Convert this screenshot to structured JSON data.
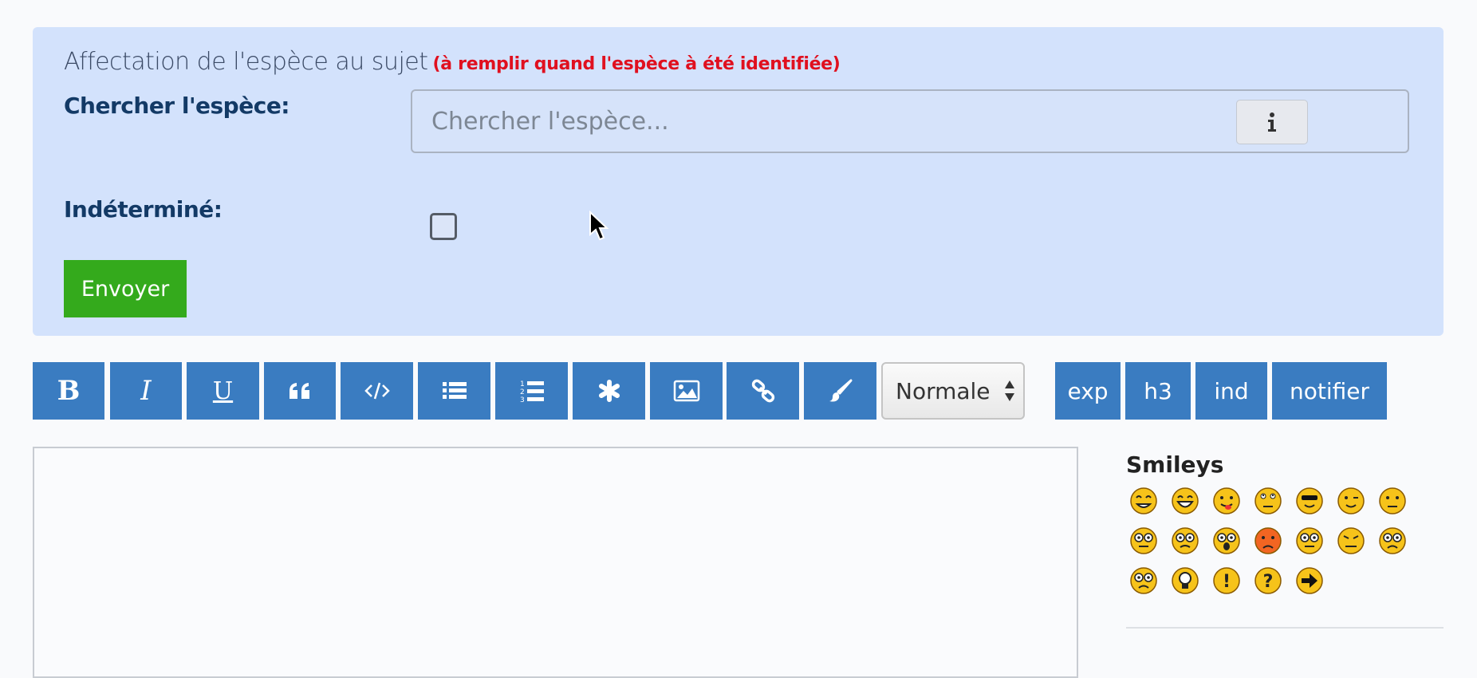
{
  "form": {
    "title": "Affectation de l'espèce au sujet",
    "hint": "(à remplir quand l'espèce à été identifiée)",
    "search_label": "Chercher l'espèce:",
    "search_placeholder": "Chercher l'espèce...",
    "search_value": "",
    "info_icon": "info-icon",
    "undetermined_label": "Indéterminé:",
    "undetermined_checked": false,
    "submit_label": "Envoyer"
  },
  "toolbar": {
    "icon_buttons": [
      "bold-icon",
      "italic-icon",
      "underline-icon",
      "quote-icon",
      "code-icon",
      "list-icon",
      "ordered-list-icon",
      "asterisk-icon",
      "image-icon",
      "link-icon",
      "brush-icon"
    ],
    "bold_glyph": "B",
    "italic_glyph": "I",
    "underline_glyph": "U",
    "size_select_value": "Normale",
    "text_buttons": [
      "exp",
      "h3",
      "ind",
      "notifier"
    ]
  },
  "editor": {
    "value": ""
  },
  "smileys": {
    "title": "Smileys",
    "items": [
      "grin",
      "laugh",
      "tongue",
      "eyes-up",
      "cool",
      "wink",
      "neutral",
      "rolleyes",
      "confused",
      "shocked",
      "angry",
      "nerd",
      "wince",
      "frown",
      "sad",
      "idea",
      "exclamation",
      "question",
      "arrow"
    ]
  },
  "colors": {
    "panel_bg": "#d3e2fc",
    "label": "#133a66",
    "hint_red": "#e0101f",
    "submit_green": "#34aa1c",
    "toolbar_blue": "#3a7cc1"
  }
}
